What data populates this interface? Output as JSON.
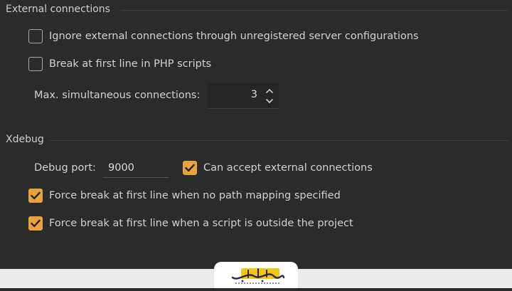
{
  "external": {
    "title": "External connections",
    "ignore_label": "Ignore external connections through unregistered server configurations",
    "ignore_checked": false,
    "break_php_label": "Break at first line in PHP scripts",
    "break_php_checked": false,
    "max_connections_label": "Max. simultaneous connections:",
    "max_connections_value": "3"
  },
  "xdebug": {
    "title": "Xdebug",
    "debug_port_label": "Debug port:",
    "debug_port_value": "9000",
    "accept_external_label": "Can accept external connections",
    "accept_external_checked": true,
    "force_break_no_mapping_label": "Force break at first line when no path mapping specified",
    "force_break_no_mapping_checked": true,
    "force_break_outside_label": "Force break at first line when a script is outside the project",
    "force_break_outside_checked": true
  },
  "colors": {
    "accent": "#e8a33d",
    "background": "#2b2b2b"
  },
  "icons": {
    "checkmark": "checkmark-icon",
    "spinner_up": "chevron-up-icon",
    "spinner_down": "chevron-down-icon",
    "watermark": "logo-icon"
  }
}
